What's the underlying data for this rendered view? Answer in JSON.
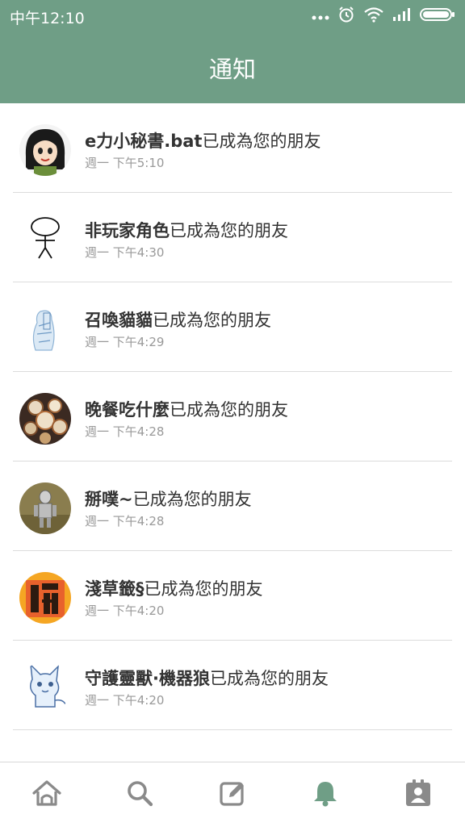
{
  "status_bar": {
    "time": "中午12:10",
    "icons": [
      "more-dots-icon",
      "alarm-icon",
      "wifi-icon",
      "signal-icon",
      "battery-icon"
    ]
  },
  "header": {
    "title": "通知"
  },
  "notifications": [
    {
      "name": "e力小秘書.bat",
      "text": "已成為您的朋友",
      "time": "週一 下午5:10"
    },
    {
      "name": "非玩家角色",
      "text": "已成為您的朋友",
      "time": "週一 下午4:30"
    },
    {
      "name": "召喚貓貓",
      "text": "已成為您的朋友",
      "time": "週一 下午4:29"
    },
    {
      "name": "晚餐吃什麼",
      "text": "已成為您的朋友",
      "time": "週一 下午4:28"
    },
    {
      "name": "掰噗~",
      "text": "已成為您的朋友",
      "time": "週一 下午4:28"
    },
    {
      "name": "淺草籤§",
      "text": "已成為您的朋友",
      "time": "週一 下午4:20"
    },
    {
      "name": "守護靈獸·機器狼",
      "text": "已成為您的朋友",
      "time": "週一 下午4:20"
    }
  ],
  "bottom_nav": {
    "items": [
      {
        "icon": "home-icon",
        "active": false
      },
      {
        "icon": "search-icon",
        "active": false
      },
      {
        "icon": "compose-icon",
        "active": false
      },
      {
        "icon": "bell-icon",
        "active": true
      },
      {
        "icon": "profile-card-icon",
        "active": false
      }
    ],
    "active_color": "#6f9e86",
    "inactive_color": "#8a8a8a"
  },
  "colors": {
    "header_bg": "#6f9e86",
    "divider": "#dcdcdc",
    "time_text": "#999999"
  }
}
